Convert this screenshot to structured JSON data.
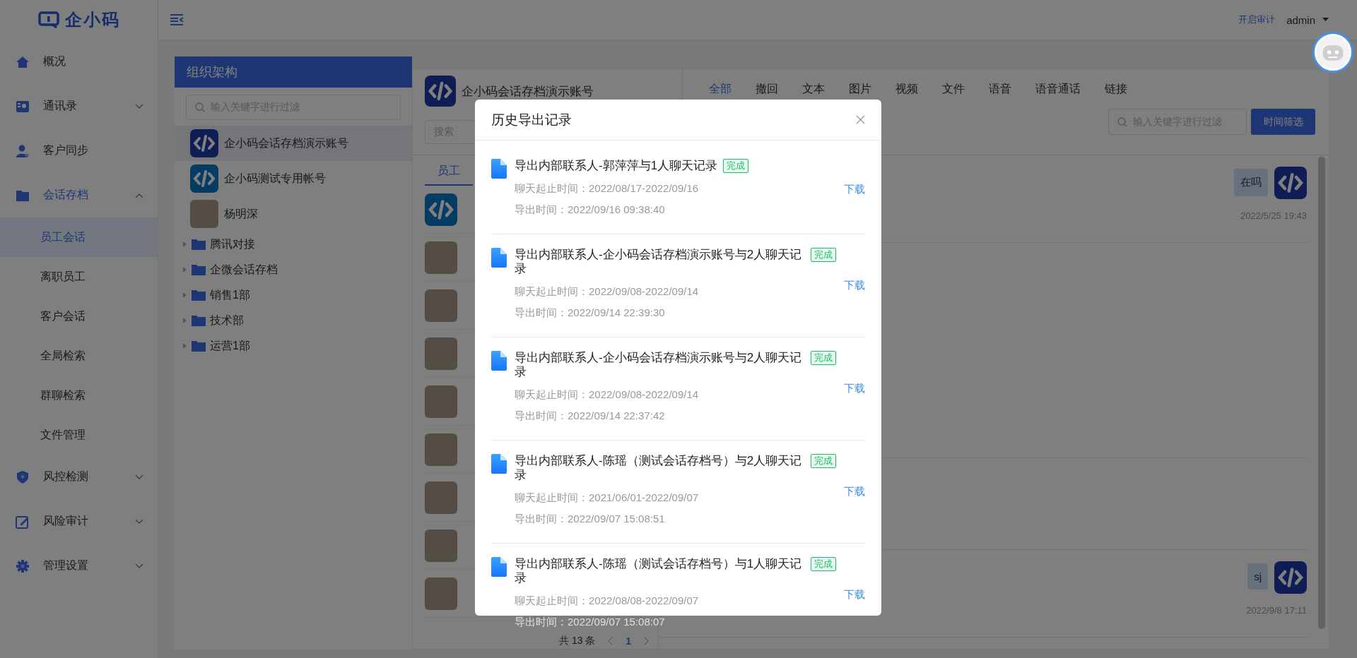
{
  "brand": {
    "name": "企小码"
  },
  "header": {
    "audit_link": "开启审计",
    "user": "admin"
  },
  "sidebar": {
    "items": [
      {
        "label": "概况"
      },
      {
        "label": "通讯录",
        "expanded": false
      },
      {
        "label": "客户同步"
      },
      {
        "label": "会话存档",
        "expanded": true,
        "children": [
          {
            "label": "员工会话",
            "selected": true
          },
          {
            "label": "离职员工",
            "selected": false
          },
          {
            "label": "客户会话",
            "selected": false
          },
          {
            "label": "全局检索",
            "selected": false
          },
          {
            "label": "群聊检索",
            "selected": false
          },
          {
            "label": "文件管理",
            "selected": false
          }
        ]
      },
      {
        "label": "风控检测",
        "expanded": false
      },
      {
        "label": "风险审计",
        "expanded": false
      },
      {
        "label": "管理设置",
        "expanded": false
      }
    ]
  },
  "org_panel": {
    "title": "组织架构",
    "search": {
      "placeholder": "输入关键字进行过滤"
    },
    "accounts": [
      {
        "name": "企小码会话存档演示账号",
        "kind": "logo",
        "selected": true
      },
      {
        "name": "企小码测试专用帐号",
        "kind": "logo",
        "selected": false
      },
      {
        "name": "杨明深",
        "kind": "photo",
        "selected": false
      }
    ],
    "departments": [
      {
        "label": "腾讯对接",
        "expanded": false
      },
      {
        "label": "企微会话存档",
        "expanded": false
      },
      {
        "label": "销售1部",
        "expanded": false
      },
      {
        "label": "技术部",
        "expanded": false
      },
      {
        "label": "运营1部",
        "expanded": false
      }
    ]
  },
  "chat_panel": {
    "account": "企小码会话存档演示账号",
    "search": {
      "placeholder": "搜索"
    },
    "tabs": [
      {
        "label": "全部",
        "selected": true
      },
      {
        "label": "撤回",
        "selected": false
      },
      {
        "label": "文本",
        "selected": false
      },
      {
        "label": "图片",
        "selected": false
      },
      {
        "label": "视频",
        "selected": false
      },
      {
        "label": "文件",
        "selected": false
      },
      {
        "label": "语音",
        "selected": false
      },
      {
        "label": "语音通话",
        "selected": false
      },
      {
        "label": "链接",
        "selected": false
      }
    ],
    "filter": {
      "placeholder": "输入关键字进行过滤"
    },
    "filter_button": "时间筛选",
    "list_tab": {
      "label": "员工",
      "selected": true
    },
    "contacts": [
      {
        "kind": "logo"
      },
      {
        "kind": "photo"
      },
      {
        "kind": "photo"
      },
      {
        "kind": "photo"
      },
      {
        "kind": "photo"
      },
      {
        "kind": "photo"
      },
      {
        "kind": "photo"
      },
      {
        "kind": "photo"
      },
      {
        "kind": "photo"
      }
    ],
    "pagination": {
      "total": "共 13 条",
      "page": "1"
    },
    "messages": [
      {
        "text": "在吗",
        "time": "2022/5/25 19:43"
      },
      {
        "text": "sj",
        "time": "2022/9/8 17:11"
      }
    ]
  },
  "modal": {
    "title": "历史导出记录",
    "records": [
      {
        "title": "导出内部联系人-郭萍萍与1人聊天记录",
        "status": "完成",
        "range": "聊天起止时间：2022/08/17-2022/09/16",
        "exported": "导出时间：2022/09/16 09:38:40",
        "action": "下载"
      },
      {
        "title": "导出内部联系人-企小码会话存档演示账号与2人聊天记录",
        "status": "完成",
        "range": "聊天起止时间：2022/09/08-2022/09/14",
        "exported": "导出时间：2022/09/14 22:39:30",
        "action": "下载"
      },
      {
        "title": "导出内部联系人-企小码会话存档演示账号与2人聊天记录",
        "status": "完成",
        "range": "聊天起止时间：2022/09/08-2022/09/14",
        "exported": "导出时间：2022/09/14 22:37:42",
        "action": "下载"
      },
      {
        "title": "导出内部联系人-陈瑶（测试会话存档号）与2人聊天记录",
        "status": "完成",
        "range": "聊天起止时间：2021/06/01-2022/09/07",
        "exported": "导出时间：2022/09/07 15:08:51",
        "action": "下载"
      },
      {
        "title": "导出内部联系人-陈瑶（测试会话存档号）与1人聊天记录",
        "status": "完成",
        "range": "聊天起止时间：2022/08/08-2022/09/07",
        "exported": "导出时间：2022/09/07 15:08:07",
        "action": "下载"
      }
    ]
  }
}
